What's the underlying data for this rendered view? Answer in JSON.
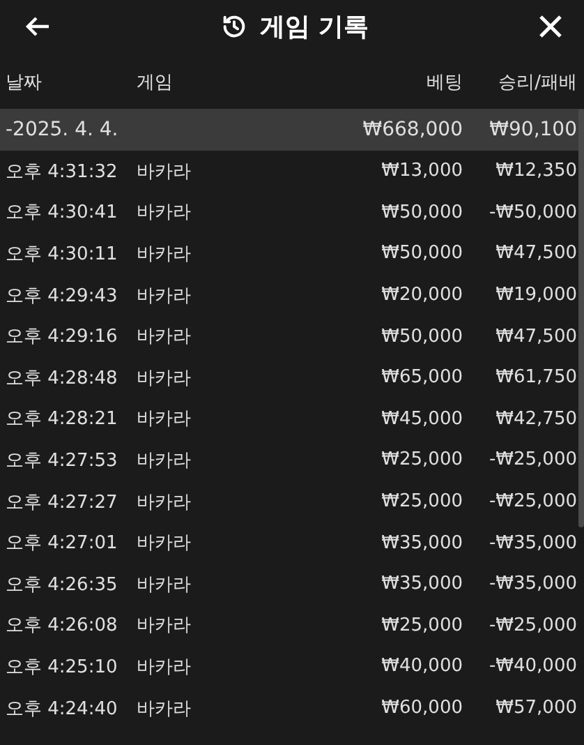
{
  "header": {
    "title": "게임 기록"
  },
  "columns": [
    "날짜",
    "게임",
    "베팅",
    "승리/패배"
  ],
  "group": {
    "date": "-2025. 4. 4.",
    "bet": "₩668,000",
    "result": "₩90,100"
  },
  "rows": [
    {
      "time": "오후 4:31:32",
      "game": "바카라",
      "bet": "₩13,000",
      "result": "₩12,350"
    },
    {
      "time": "오후 4:30:41",
      "game": "바카라",
      "bet": "₩50,000",
      "result": "-₩50,000"
    },
    {
      "time": "오후 4:30:11",
      "game": "바카라",
      "bet": "₩50,000",
      "result": "₩47,500"
    },
    {
      "time": "오후 4:29:43",
      "game": "바카라",
      "bet": "₩20,000",
      "result": "₩19,000"
    },
    {
      "time": "오후 4:29:16",
      "game": "바카라",
      "bet": "₩50,000",
      "result": "₩47,500"
    },
    {
      "time": "오후 4:28:48",
      "game": "바카라",
      "bet": "₩65,000",
      "result": "₩61,750"
    },
    {
      "time": "오후 4:28:21",
      "game": "바카라",
      "bet": "₩45,000",
      "result": "₩42,750"
    },
    {
      "time": "오후 4:27:53",
      "game": "바카라",
      "bet": "₩25,000",
      "result": "-₩25,000"
    },
    {
      "time": "오후 4:27:27",
      "game": "바카라",
      "bet": "₩25,000",
      "result": "-₩25,000"
    },
    {
      "time": "오후 4:27:01",
      "game": "바카라",
      "bet": "₩35,000",
      "result": "-₩35,000"
    },
    {
      "time": "오후 4:26:35",
      "game": "바카라",
      "bet": "₩35,000",
      "result": "-₩35,000"
    },
    {
      "time": "오후 4:26:08",
      "game": "바카라",
      "bet": "₩25,000",
      "result": "-₩25,000"
    },
    {
      "time": "오후 4:25:10",
      "game": "바카라",
      "bet": "₩40,000",
      "result": "-₩40,000"
    },
    {
      "time": "오후 4:24:40",
      "game": "바카라",
      "bet": "₩60,000",
      "result": "₩57,000"
    }
  ]
}
